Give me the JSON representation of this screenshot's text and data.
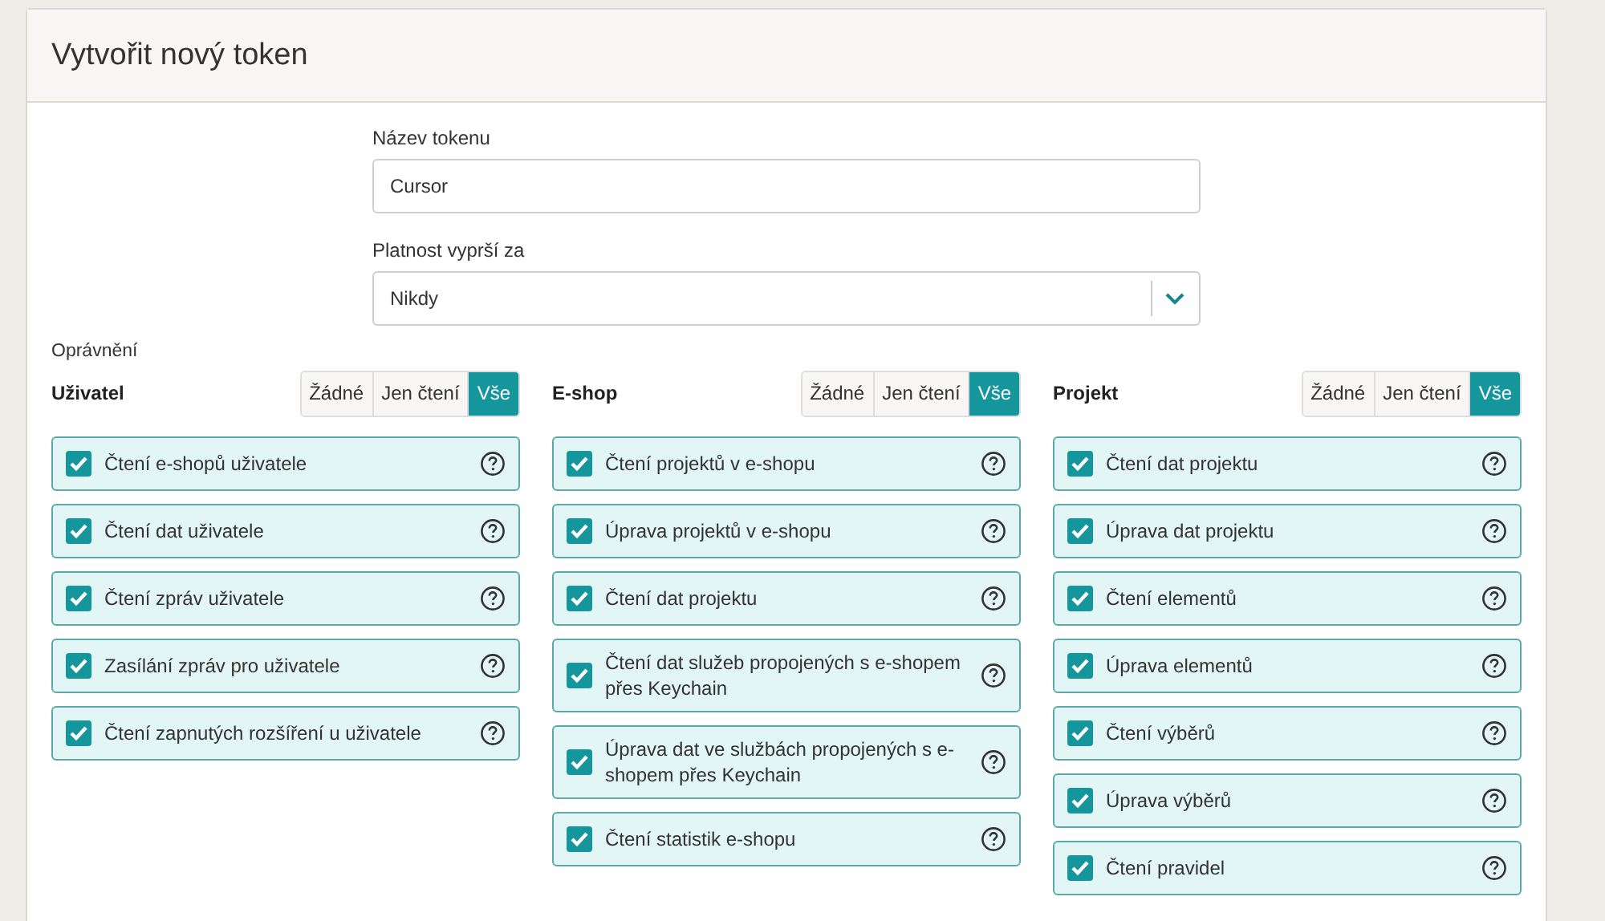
{
  "title": "Vytvořit nový token",
  "fields": [
    {
      "label": "Název tokenu",
      "kind": "input",
      "value": "Cursor"
    },
    {
      "label": "Platnost vyprší za",
      "kind": "select",
      "value": "Nikdy"
    }
  ],
  "permissions_label": "Oprávnění",
  "groups": [
    {
      "name": "Uživatel",
      "modes": [
        {
          "label": "Žádné",
          "selected": false
        },
        {
          "label": "Jen čtení",
          "selected": false
        },
        {
          "label": "Vše",
          "selected": true
        }
      ],
      "items": [
        {
          "label": "Čtení e-shopů uživatele",
          "checked": true
        },
        {
          "label": "Čtení dat uživatele",
          "checked": true
        },
        {
          "label": "Čtení zpráv uživatele",
          "checked": true
        },
        {
          "label": "Zasílání zpráv pro uživatele",
          "checked": true
        },
        {
          "label": "Čtení zapnutých rozšíření u uživatele",
          "checked": true
        }
      ]
    },
    {
      "name": "E-shop",
      "modes": [
        {
          "label": "Žádné",
          "selected": false
        },
        {
          "label": "Jen čtení",
          "selected": false
        },
        {
          "label": "Vše",
          "selected": true
        }
      ],
      "items": [
        {
          "label": "Čtení projektů v e-shopu",
          "checked": true
        },
        {
          "label": "Úprava projektů v e-shopu",
          "checked": true
        },
        {
          "label": "Čtení dat projektu",
          "checked": true
        },
        {
          "label": "Čtení dat služeb propojených s e-shopem přes Keychain",
          "checked": true
        },
        {
          "label": "Úprava dat ve službách propojených s e-shopem přes Keychain",
          "checked": true
        },
        {
          "label": "Čtení statistik e-shopu",
          "checked": true
        }
      ]
    },
    {
      "name": "Projekt",
      "modes": [
        {
          "label": "Žádné",
          "selected": false
        },
        {
          "label": "Jen čtení",
          "selected": false
        },
        {
          "label": "Vše",
          "selected": true
        }
      ],
      "items": [
        {
          "label": "Čtení dat projektu",
          "checked": true
        },
        {
          "label": "Úprava dat projektu",
          "checked": true
        },
        {
          "label": "Čtení elementů",
          "checked": true
        },
        {
          "label": "Úprava elementů",
          "checked": true
        },
        {
          "label": "Čtení výběrů",
          "checked": true
        },
        {
          "label": "Úprava výběrů",
          "checked": true
        },
        {
          "label": "Čtení pravidel",
          "checked": true
        }
      ]
    }
  ]
}
